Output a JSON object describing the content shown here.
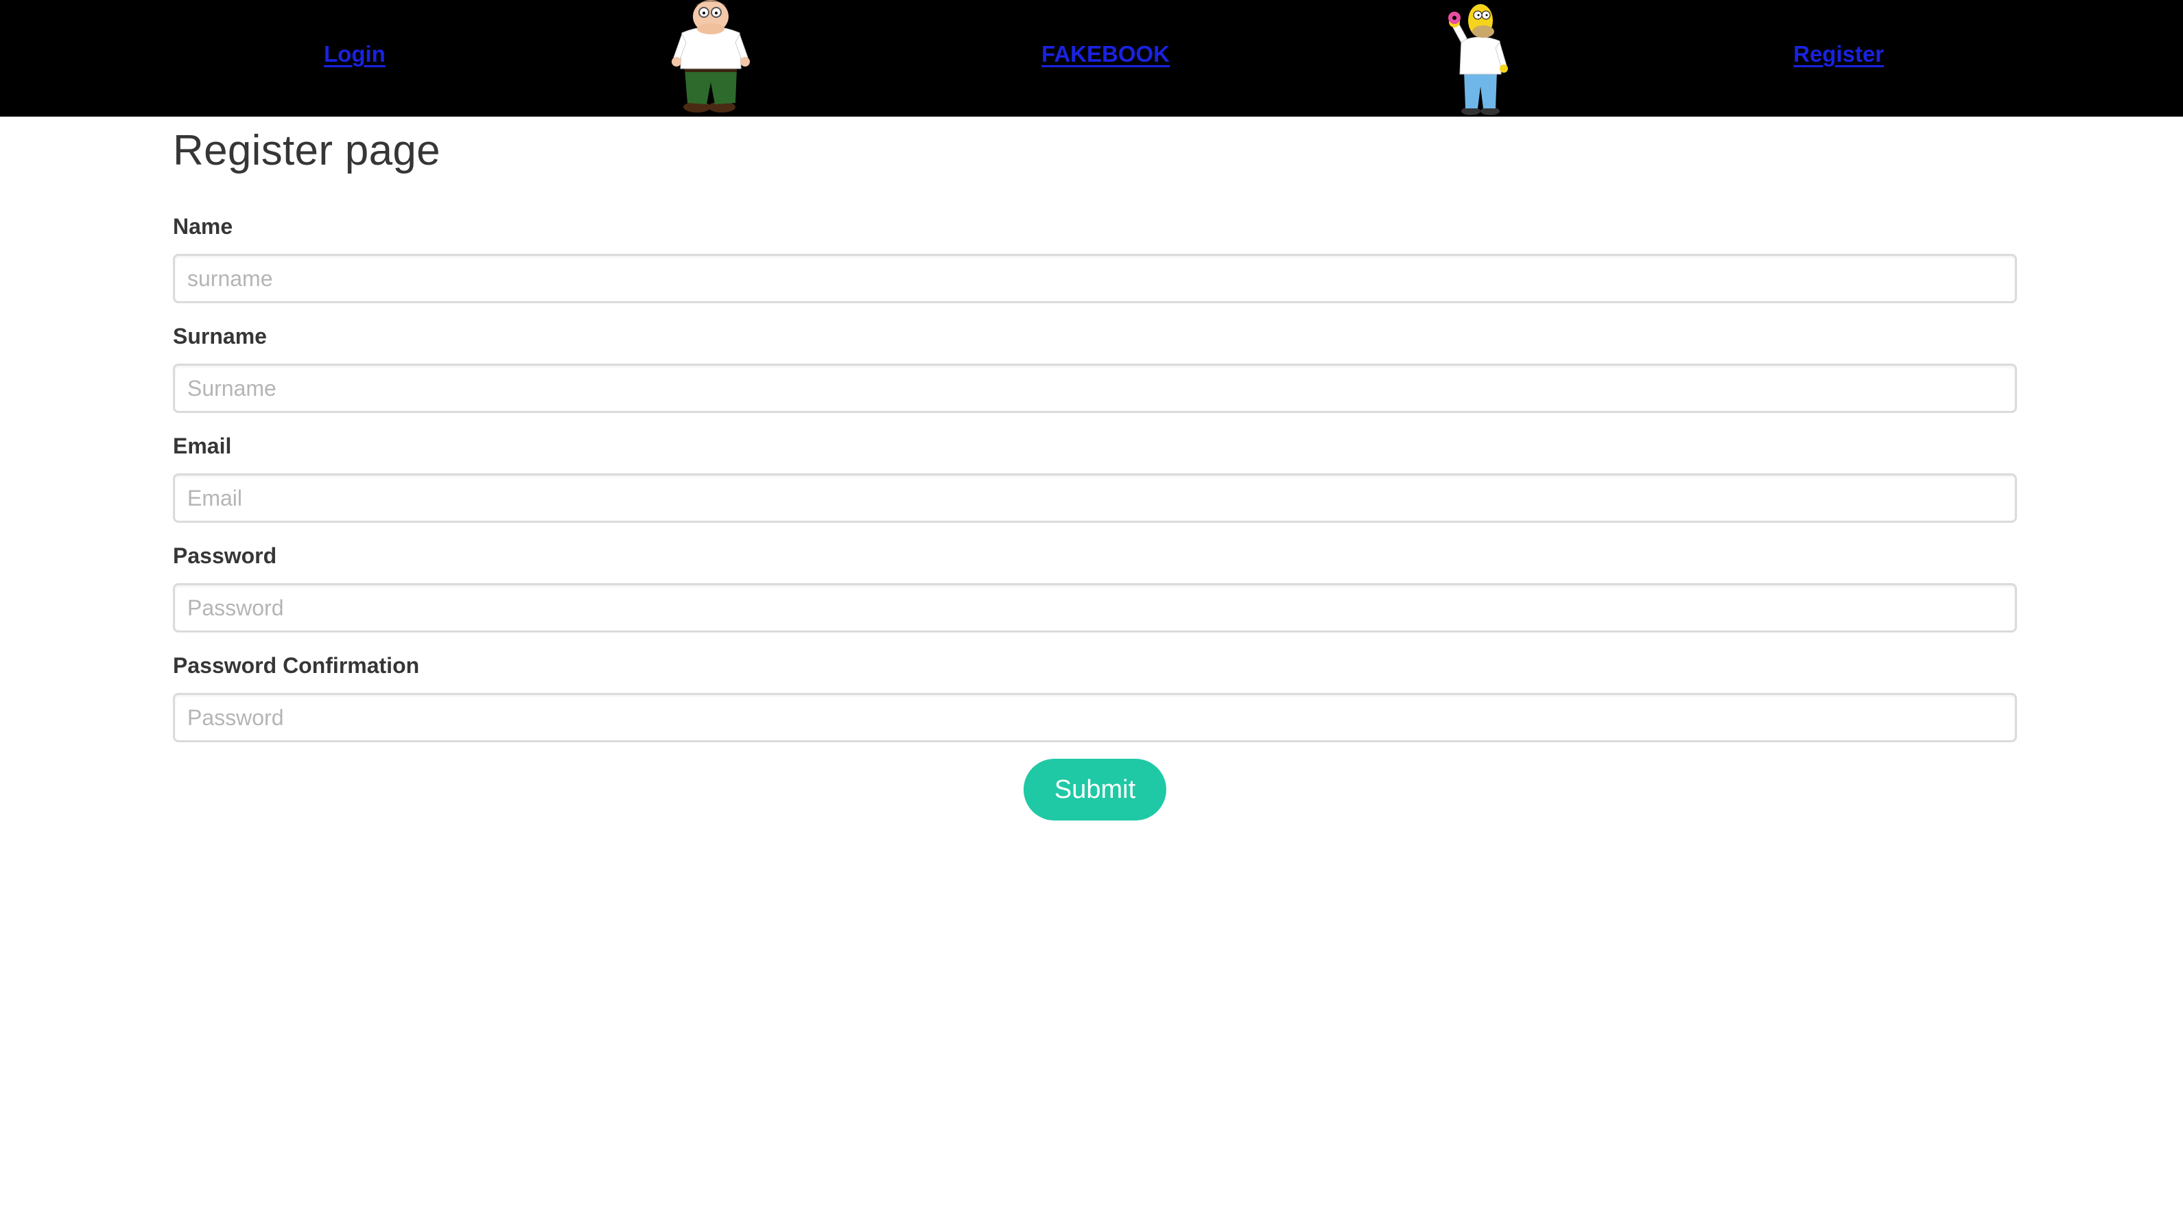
{
  "navbar": {
    "login_label": "Login",
    "brand_label": "FAKEBOOK",
    "register_label": "Register",
    "link_color": "#1a22e0",
    "background": "#000000",
    "left_character_icon": "peter-griffin-icon",
    "right_character_icon": "homer-simpson-icon"
  },
  "page": {
    "title": "Register page"
  },
  "form": {
    "fields": [
      {
        "label": "Name",
        "placeholder": "surname",
        "value": ""
      },
      {
        "label": "Surname",
        "placeholder": "Surname",
        "value": ""
      },
      {
        "label": "Email",
        "placeholder": "Email",
        "value": ""
      },
      {
        "label": "Password",
        "placeholder": "Password",
        "value": ""
      },
      {
        "label": "Password Confirmation",
        "placeholder": "Password",
        "value": ""
      }
    ],
    "submit_label": "Submit",
    "submit_color": "#1fc9a5"
  }
}
